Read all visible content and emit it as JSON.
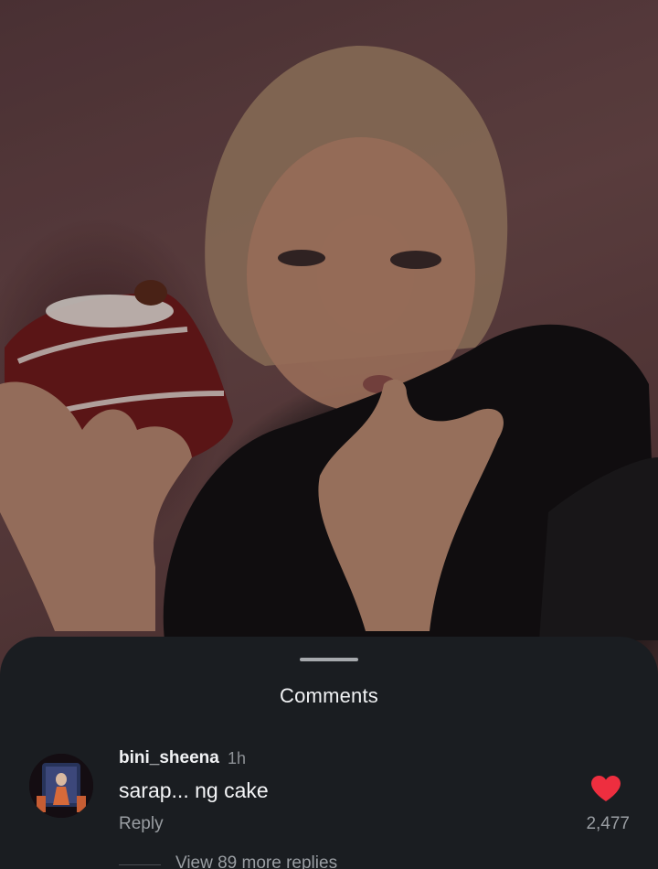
{
  "post": {
    "image_alt": "woman eating red velvet cake"
  },
  "comments_sheet": {
    "title": "Comments",
    "comment": {
      "username": "bini_sheena",
      "timestamp": "1h",
      "text": "sarap... ng cake",
      "reply_label": "Reply",
      "like_count": "2,477",
      "liked": true,
      "view_replies_label": "View 89 more replies"
    }
  },
  "colors": {
    "sheet_background": "#1a1d21",
    "like_heart": "#ee2e3f",
    "primary_text": "#f1f2f4",
    "secondary_text": "#9a9ea3"
  },
  "icons": {
    "like": "heart-icon",
    "handle": "drag-handle"
  }
}
